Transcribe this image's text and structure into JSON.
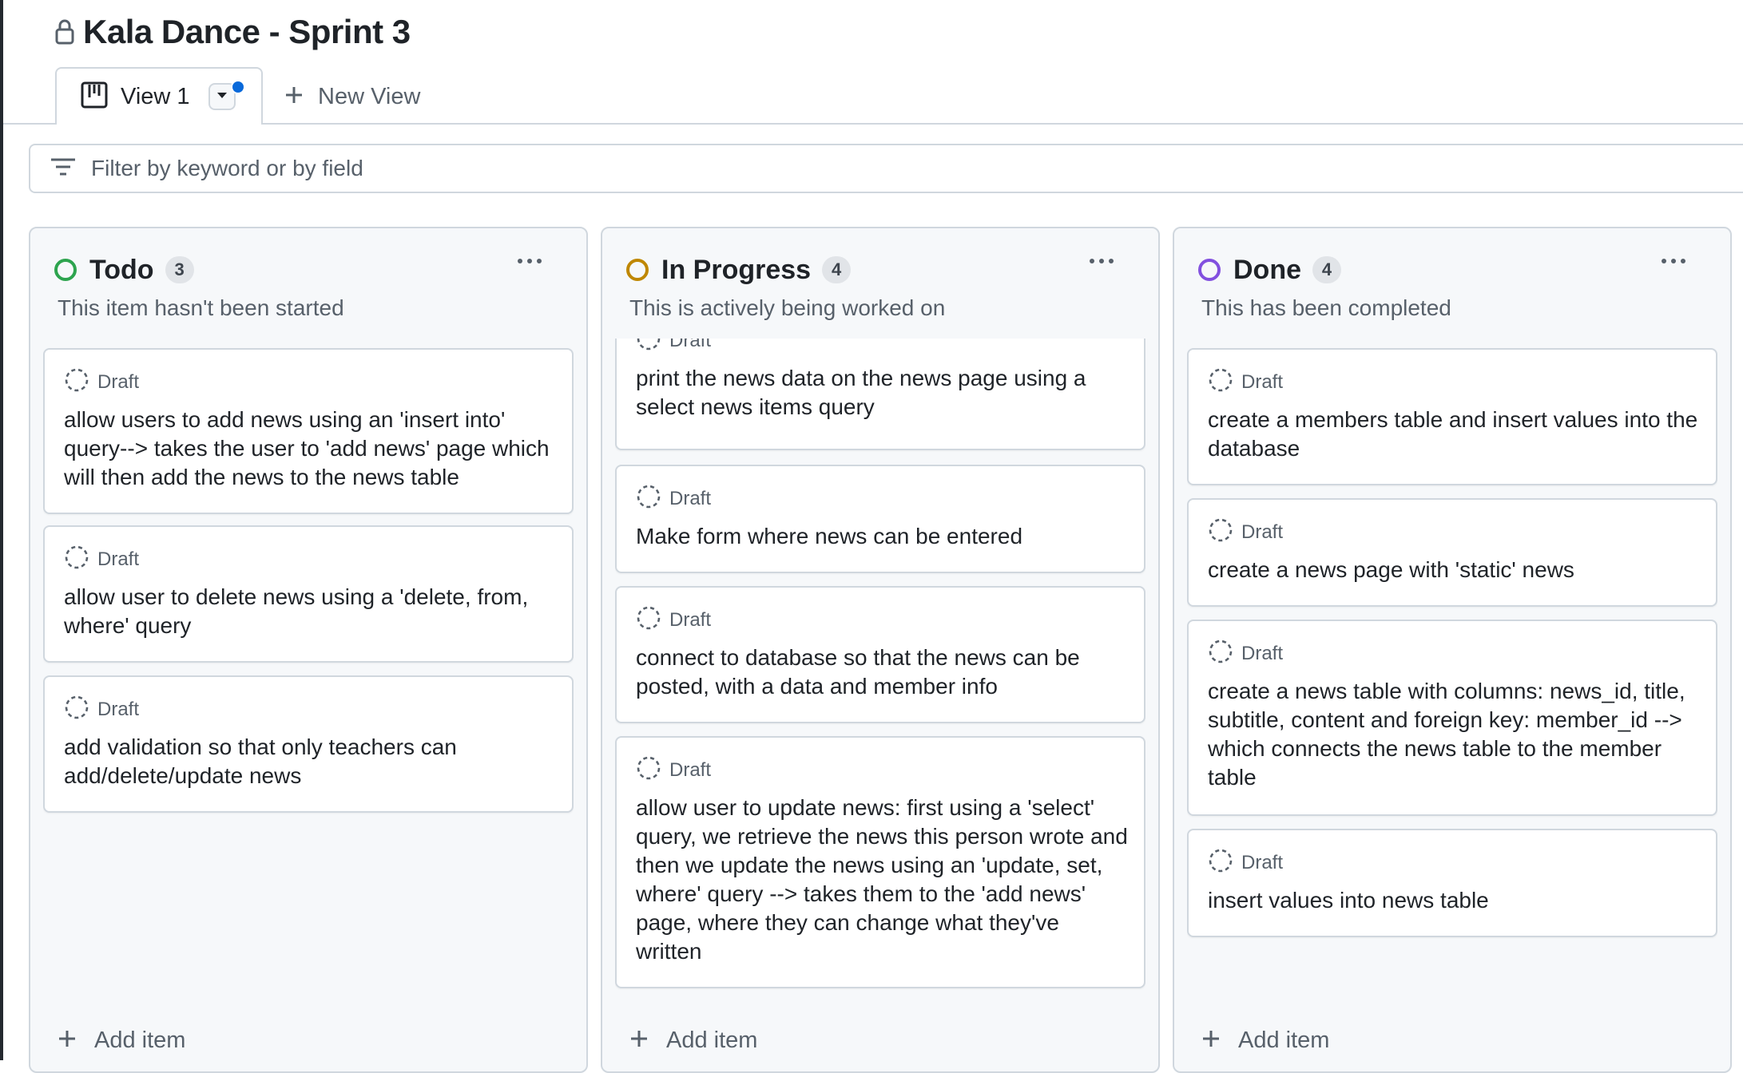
{
  "project": {
    "title": "Kala Dance - Sprint 3"
  },
  "tabs": {
    "active_label": "View 1",
    "new_view_label": "New View"
  },
  "filter": {
    "placeholder": "Filter by keyword or by field"
  },
  "icons": {
    "lock": "lock-icon",
    "board": "project-board-icon",
    "view_menu": "triangle-down-icon",
    "plus": "plus-icon",
    "filter": "filter-icon",
    "kebab": "kebab-horizontal-icon",
    "draft": "issue-draft-icon"
  },
  "colors": {
    "todo": "#2da44e",
    "in_progress": "#bf8700",
    "done": "#8250df",
    "accent": "#0969da"
  },
  "columns": [
    {
      "name": "Todo",
      "count": "3",
      "description": "This item hasn't been started",
      "add_item_label": "Add item",
      "cards": [
        {
          "type": "Draft",
          "title": "allow users to add news using an 'insert into' query--> takes the user to 'add news' page which will then add the news to the news table"
        },
        {
          "type": "Draft",
          "title": "allow user to delete news using a 'delete, from, where' query"
        },
        {
          "type": "Draft",
          "title": "add validation so that only teachers can add/delete/update news"
        }
      ]
    },
    {
      "name": "In Progress",
      "count": "4",
      "description": "This is actively being worked on",
      "add_item_label": "Add item",
      "cards": [
        {
          "type": "Draft",
          "title": "print the news data on the news page using a select news items query"
        },
        {
          "type": "Draft",
          "title": "Make form where news can be entered"
        },
        {
          "type": "Draft",
          "title": "connect to database so that the news can be posted, with a data and member info"
        },
        {
          "type": "Draft",
          "title": "allow user to update news: first using a 'select' query, we retrieve the news this person wrote and then we update the news using an 'update, set, where' query --> takes them to the 'add news' page, where they can change what they've written"
        }
      ]
    },
    {
      "name": "Done",
      "count": "4",
      "description": "This has been completed",
      "add_item_label": "Add item",
      "cards": [
        {
          "type": "Draft",
          "title": "create a members table and insert values into the database"
        },
        {
          "type": "Draft",
          "title": "create a news page with 'static' news"
        },
        {
          "type": "Draft",
          "title": "create a news table with columns: news_id, title, subtitle, content and foreign key: member_id --> which connects the news table to the member table"
        },
        {
          "type": "Draft",
          "title": "insert values into news table"
        }
      ]
    }
  ]
}
